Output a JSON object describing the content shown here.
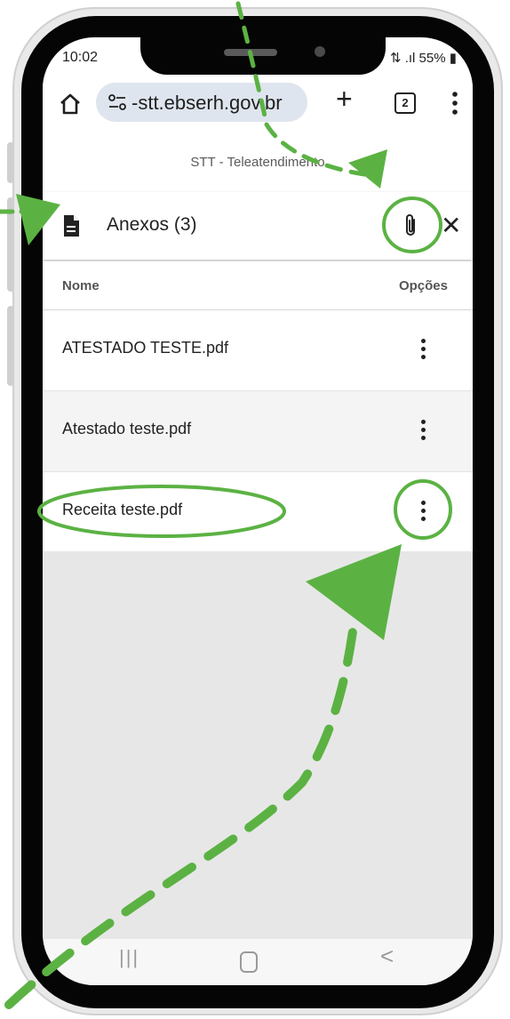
{
  "status_bar": {
    "time": "10:02",
    "right": "55%"
  },
  "browser": {
    "url": "-stt.ebserh.gov.br",
    "tab_count": "2",
    "new_tab_label": "+"
  },
  "page": {
    "title": "STT - Teleatendimento"
  },
  "dialog": {
    "title": "Anexos (3)",
    "col_name": "Nome",
    "col_options": "Opções",
    "files": [
      {
        "name": "ATESTADO TESTE.pdf"
      },
      {
        "name": "Atestado teste.pdf"
      },
      {
        "name": "Receita teste.pdf"
      }
    ]
  },
  "nav": {
    "recent": "|||",
    "back": "<"
  },
  "colors": {
    "annotation": "#5bb243",
    "dialog_gray": "#e7e7e7"
  },
  "icons": [
    "home-icon",
    "site-settings-icon",
    "tab-switcher-icon",
    "more-vert-icon",
    "document-icon",
    "paperclip-icon",
    "close-icon"
  ]
}
